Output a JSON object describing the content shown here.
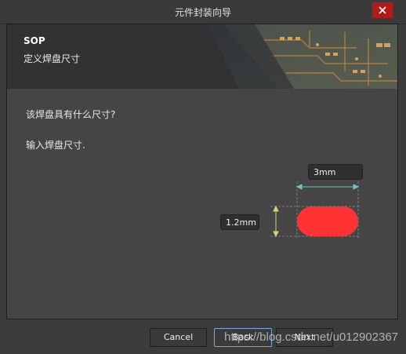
{
  "window": {
    "title": "元件封装向导",
    "close_icon": "close-icon"
  },
  "banner": {
    "title": "SOP",
    "subtitle": "定义焊盘尺寸",
    "image": "pcb-circuit-image"
  },
  "content": {
    "question": "该焊盘具有什么尺寸?",
    "instruction": "输入焊盘尺寸."
  },
  "pad": {
    "width_value": "3mm",
    "height_value": "1.2mm",
    "pad_color": "#ff3333",
    "width_arrow_color": "#6fc3c9",
    "height_arrow_color": "#d6d27a"
  },
  "buttons": {
    "cancel": "Cancel",
    "back": "Back",
    "next": "Next"
  },
  "watermark": "https://blog.csdn.net/u012902367",
  "colors": {
    "close_button": "#b31b1b",
    "background": "#454545",
    "banner_bg": "#323232"
  }
}
